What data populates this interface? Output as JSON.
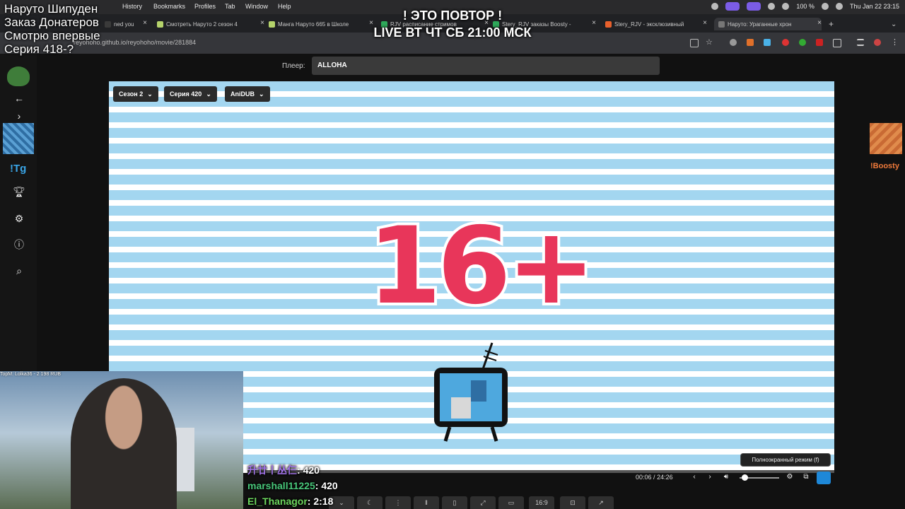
{
  "menubar": {
    "items": [
      "History",
      "Bookmarks",
      "Profiles",
      "Tab",
      "Window",
      "Help"
    ],
    "battery": "100 %",
    "clock": "Thu Jan 22  23:15"
  },
  "tabs": [
    {
      "label": "ned you",
      "fav_color": "#3a3a3a"
    },
    {
      "label": "Смотреть Наруто 2 сезон 4",
      "fav_color": "#b5d36b"
    },
    {
      "label": "Манга Наруто 665 в Школе",
      "fav_color": "#b5d36b"
    },
    {
      "label": "RJV расписание стримов",
      "fav_color": "#2ea85a"
    },
    {
      "label": "Stery_RJV заказы Boosty -",
      "fav_color": "#2ea85a"
    },
    {
      "label": "Stery_RJV - эксклюзивный",
      "fav_color": "#e8602c"
    },
    {
      "label": "Наруто: Ураганные хрон",
      "fav_color": "#777777"
    }
  ],
  "address": {
    "url": "reyohoho.github.io/reyohoho/movie/281884"
  },
  "player": {
    "label": "Плеер:",
    "value": "ALLOHA",
    "season": "Сезон 2",
    "episode": "Серия 420",
    "voice": "AniDUB",
    "rating_text": "16+",
    "time_current": "00:06",
    "time_separator": "/",
    "time_total": "24:26",
    "progress": 0.004,
    "volume": 0.05,
    "tooltip": "Полноэкранный режим (f)"
  },
  "toolbar_bottom": {
    "aspect_label": "16:9"
  },
  "sidebar": {
    "tg_label": "!Tg"
  },
  "boosty": {
    "label": "!Boosty"
  },
  "overlay": {
    "left_lines": [
      "Наруто Шипуден",
      "Заказ Донатеров",
      "Смотрю впервые",
      "Серия 418-?"
    ],
    "center_line1": "! ЭТО ПОВТОР !",
    "center_line2": "LIVE ВТ ЧТ СБ 21:00 МСК",
    "topm": "TopM: Lolka36 - 2 198 RUB"
  },
  "chat": [
    {
      "user": "升廿丨丛仨",
      "value": "420"
    },
    {
      "user": "marshall11225",
      "value": "420"
    },
    {
      "user": "El_Thanagor",
      "value": "2:18"
    }
  ]
}
